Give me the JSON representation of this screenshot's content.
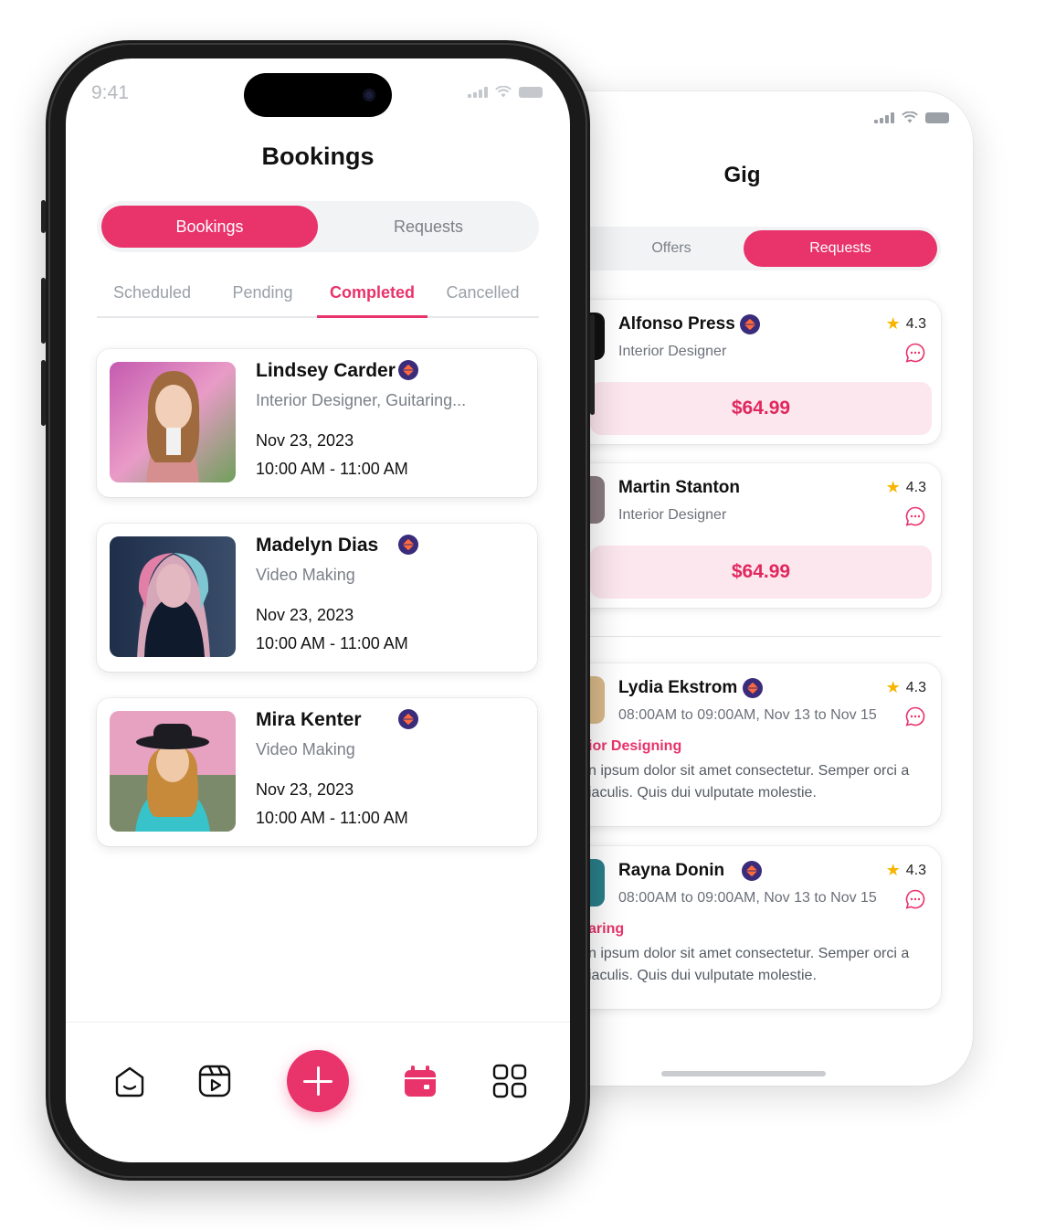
{
  "back_screen": {
    "title": "Gig",
    "segments": {
      "offers": "Offers",
      "requests": "Requests",
      "active": "Requests"
    },
    "offer_cards": [
      {
        "name": "Alfonso Press",
        "role": "Interior Designer",
        "rating": "4.3",
        "price": "$64.99"
      },
      {
        "name": "Martin Stanton",
        "role": "Interior Designer",
        "rating": "4.3",
        "price": "$64.99"
      }
    ],
    "request_cards": [
      {
        "name": "Lydia Ekstrom",
        "schedule": "08:00AM to 09:00AM, Nov 13 to Nov 15",
        "rating": "4.3",
        "tag": "ior Designing",
        "description": "n ipsum dolor sit amet consectetur. Semper orci a iaculis. Quis dui vulputate molestie."
      },
      {
        "name": "Rayna Donin",
        "schedule": "08:00AM to 09:00AM, Nov 13 to Nov 15",
        "rating": "4.3",
        "tag": "aring",
        "description": "n ipsum dolor sit amet consectetur. Semper orci a iaculis. Quis dui vulputate molestie."
      }
    ]
  },
  "front_screen": {
    "status_time": "9:41",
    "title": "Bookings",
    "segments": {
      "bookings": "Bookings",
      "requests": "Requests",
      "active": "Bookings"
    },
    "subtabs": [
      "Scheduled",
      "Pending",
      "Completed",
      "Cancelled"
    ],
    "active_subtab": "Completed",
    "bookings": [
      {
        "name": "Lindsey Carder",
        "skills": "Interior Designer, Guitaring...",
        "date": "Nov 23, 2023",
        "time": "10:00 AM - 11:00 AM"
      },
      {
        "name": "Madelyn Dias",
        "skills": "Video Making",
        "date": "Nov 23, 2023",
        "time": "10:00 AM - 11:00 AM"
      },
      {
        "name": "Mira Kenter",
        "skills": "Video Making",
        "date": "Nov 23, 2023",
        "time": "10:00 AM - 11:00 AM"
      }
    ],
    "nav": [
      "home-icon",
      "reels-icon",
      "add-icon",
      "calendar-icon",
      "grid-icon"
    ],
    "active_nav": "calendar-icon"
  },
  "colors": {
    "accent": "#e8336b",
    "price_bg": "#fde7ee",
    "badge": "#3a2c7a",
    "star": "#f7b500"
  }
}
